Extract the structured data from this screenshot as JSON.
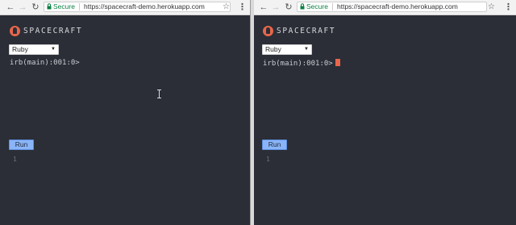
{
  "browser": {
    "secure_label": "Secure",
    "url": "https://spacecraft-demo.herokuapp.com",
    "back_icon": "back-arrow-icon",
    "forward_icon": "forward-arrow-icon",
    "reload_icon": "reload-icon",
    "star_icon": "star-icon",
    "menu_icon": "kebab-menu-icon"
  },
  "app": {
    "brand": "SPACECRAFT",
    "language_selected": "Ruby",
    "prompt": "irb(main):001:0>",
    "run_label": "Run",
    "line_number": "1"
  },
  "colors": {
    "editor_bg": "#2b2e36",
    "accent": "#e8664b",
    "run_button": "#8ab4f8",
    "secure_green": "#0b8043"
  }
}
